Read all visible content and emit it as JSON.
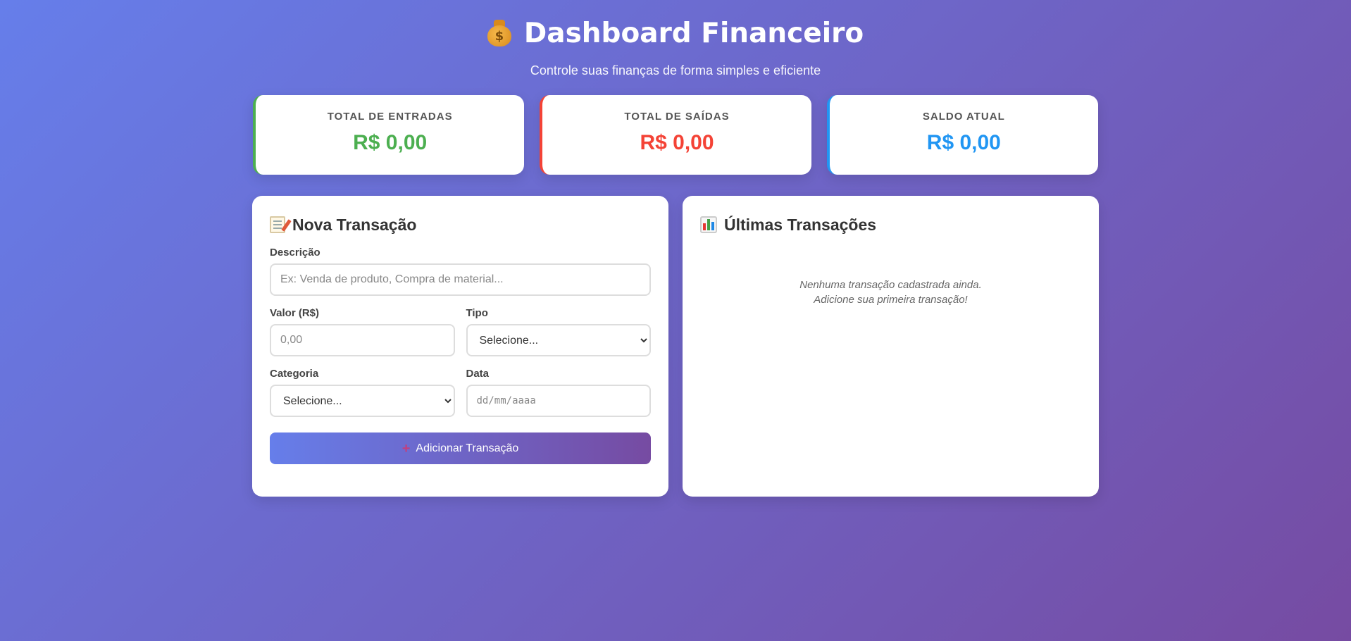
{
  "header": {
    "title": "Dashboard Financeiro",
    "icon": "money-bag-icon",
    "subtitle": "Controle suas finanças de forma simples e eficiente"
  },
  "summary": {
    "entradas": {
      "label": "Total de Entradas",
      "value": "R$ 0,00",
      "color": "#4caf50"
    },
    "saidas": {
      "label": "Total de Saídas",
      "value": "R$ 0,00",
      "color": "#f44336"
    },
    "saldo": {
      "label": "Saldo Atual",
      "value": "R$ 0,00",
      "color": "#2196f3"
    }
  },
  "form": {
    "title": "Nova Transação",
    "icon": "memo-icon",
    "descricao": {
      "label": "Descrição",
      "placeholder": "Ex: Venda de produto, Compra de material..."
    },
    "valor": {
      "label": "Valor (R$)",
      "placeholder": "0,00"
    },
    "tipo": {
      "label": "Tipo",
      "selected": "Selecione..."
    },
    "categoria": {
      "label": "Categoria",
      "selected": "Selecione..."
    },
    "data": {
      "label": "Data",
      "placeholder": "dd/mm/aaaa"
    },
    "submit_label": "Adicionar Transação",
    "submit_icon": "plus-icon"
  },
  "transactions": {
    "title": "Últimas Transações",
    "icon": "bar-chart-icon",
    "empty_line1": "Nenhuma transação cadastrada ainda.",
    "empty_line2": "Adicione sua primeira transação!"
  },
  "colors": {
    "gradient_start": "#667eea",
    "gradient_end": "#764ba2"
  }
}
